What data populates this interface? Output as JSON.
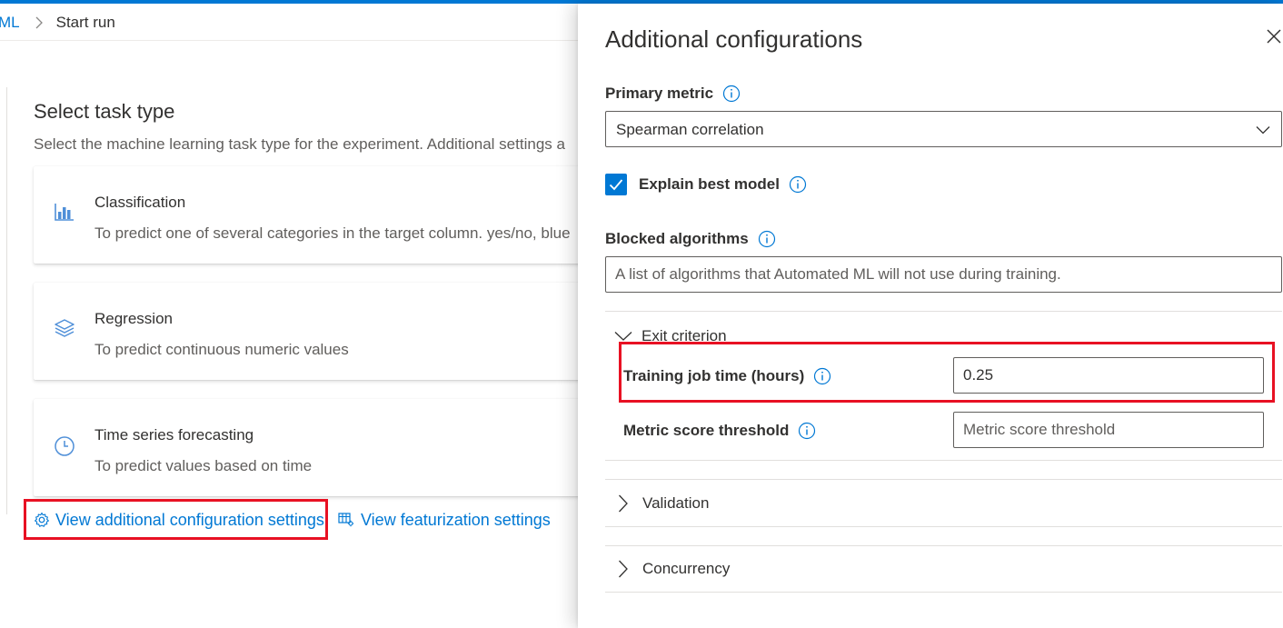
{
  "breadcrumb": {
    "parent": "ML",
    "current": "Start run"
  },
  "task_section": {
    "title": "Select task type",
    "description": "Select the machine learning task type for the experiment. Additional settings a",
    "cards": [
      {
        "icon": "bar-chart-icon",
        "name": "Classification",
        "description": "To predict one of several categories in the target column. yes/no, blue"
      },
      {
        "icon": "layers-icon",
        "name": "Regression",
        "description": "To predict continuous numeric values"
      },
      {
        "icon": "clock-icon",
        "name": "Time series forecasting",
        "description": "To predict values based on time"
      }
    ]
  },
  "links": {
    "additional_config": "View additional configuration settings",
    "featurization": "View featurization settings"
  },
  "panel": {
    "title": "Additional configurations",
    "primary_metric": {
      "label": "Primary metric",
      "value": "Spearman correlation"
    },
    "explain_best_model": {
      "label": "Explain best model",
      "checked": true
    },
    "blocked_algorithms": {
      "label": "Blocked algorithms",
      "placeholder": "A list of algorithms that Automated ML will not use during training."
    },
    "exit_criterion": {
      "label": "Exit criterion",
      "expanded": true,
      "training_job_time": {
        "label": "Training job time (hours)",
        "value": "0.25"
      },
      "metric_score_threshold": {
        "label": "Metric score threshold",
        "placeholder": "Metric score threshold"
      }
    },
    "validation": {
      "label": "Validation",
      "expanded": false
    },
    "concurrency": {
      "label": "Concurrency",
      "expanded": false
    }
  },
  "colors": {
    "accent": "#0078d4",
    "highlight": "#e81123",
    "text": "#323130",
    "subtext": "#605e5c"
  }
}
